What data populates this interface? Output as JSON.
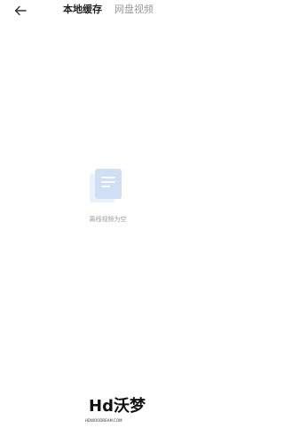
{
  "header": {
    "back_icon": "arrow-left-icon",
    "tabs": [
      {
        "label": "本地缓存",
        "active": true
      },
      {
        "label": "网盘视频",
        "active": false
      }
    ]
  },
  "empty_state": {
    "icon": "document-stack-icon",
    "message": "离线视频为空"
  },
  "watermark": {
    "logo": "Hd沃梦",
    "url": "HDWOODREAM.COM"
  },
  "colors": {
    "background": "#ffffff",
    "active_tab": "#222222",
    "inactive_tab": "#9a9a9a",
    "empty_icon_light": "#e6eef9",
    "empty_icon_dark": "#c9dcf3"
  }
}
